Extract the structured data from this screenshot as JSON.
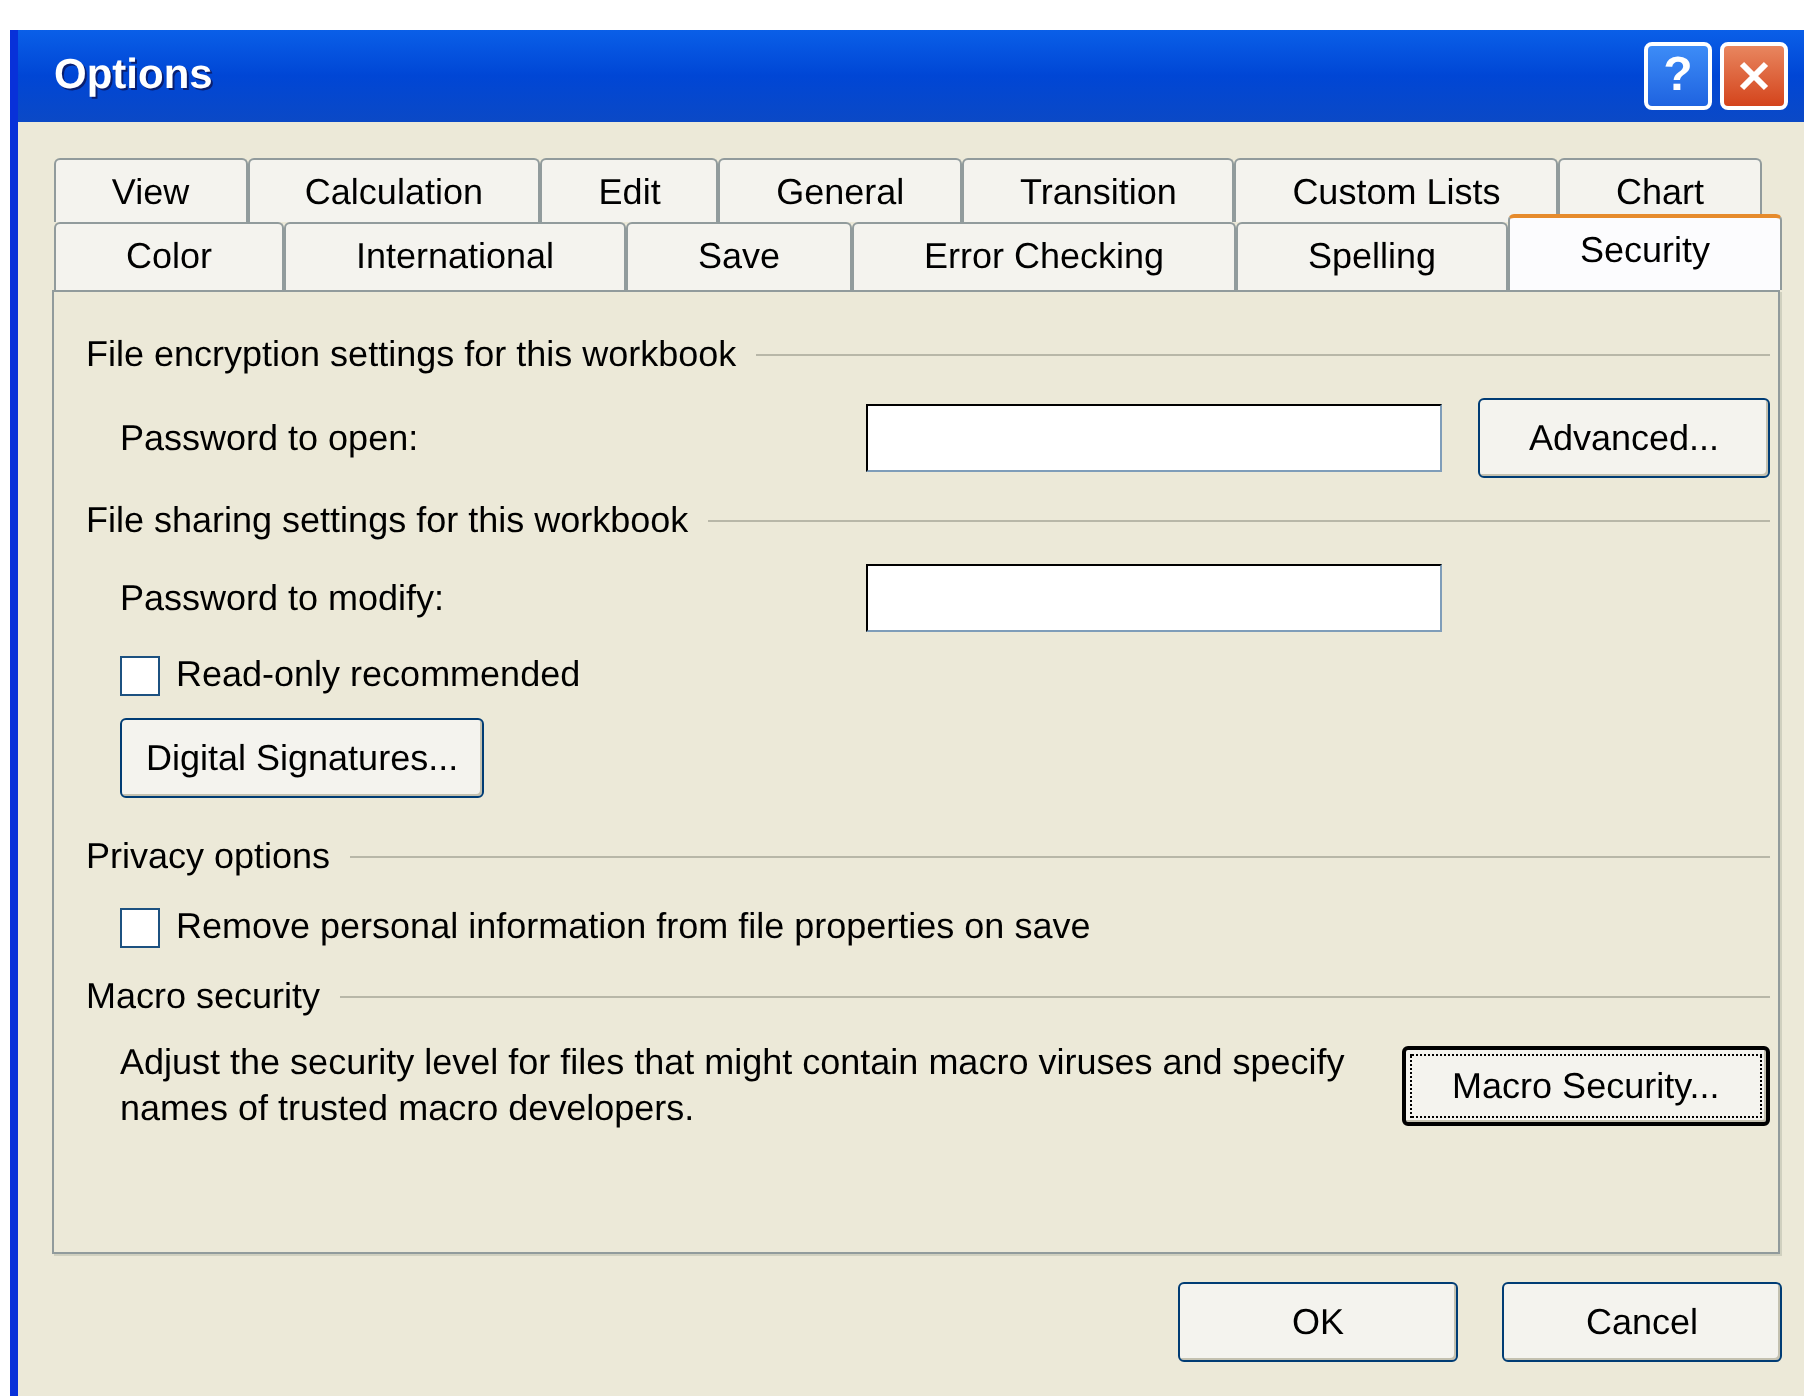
{
  "window": {
    "title": "Options"
  },
  "title_buttons": [
    {
      "kind": "help",
      "label": "?"
    },
    {
      "kind": "close"
    }
  ],
  "tab_rows": [
    [
      {
        "label": "View",
        "selected": false
      },
      {
        "label": "Calculation",
        "selected": false
      },
      {
        "label": "Edit",
        "selected": false
      },
      {
        "label": "General",
        "selected": false
      },
      {
        "label": "Transition",
        "selected": false
      },
      {
        "label": "Custom Lists",
        "selected": false
      },
      {
        "label": "Chart",
        "selected": false
      }
    ],
    [
      {
        "label": "Color",
        "selected": false
      },
      {
        "label": "International",
        "selected": false
      },
      {
        "label": "Save",
        "selected": false
      },
      {
        "label": "Error Checking",
        "selected": false
      },
      {
        "label": "Spelling",
        "selected": false
      },
      {
        "label": "Security",
        "selected": true
      }
    ]
  ],
  "sections": [
    {
      "heading": "File encryption settings for this workbook",
      "items": [
        {
          "kind": "password",
          "label": "Password to open:",
          "button": "Advanced...",
          "focused": false
        }
      ]
    },
    {
      "heading": "File sharing settings for this workbook",
      "items": [
        {
          "kind": "password",
          "label": "Password to modify:"
        },
        {
          "kind": "checkbox",
          "label": "Read-only recommended",
          "checked": false
        },
        {
          "kind": "button",
          "label": "Digital Signatures...",
          "focused": false
        }
      ]
    },
    {
      "heading": "Privacy options",
      "items": [
        {
          "kind": "checkbox",
          "label": "Remove personal information from file properties on save",
          "checked": false
        }
      ]
    },
    {
      "heading": "Macro security",
      "items": [
        {
          "kind": "text_button",
          "text": "Adjust the security level for files that might contain macro viruses and specify names of trusted macro developers.",
          "button": "Macro Security...",
          "focused": true
        }
      ]
    }
  ],
  "footer_buttons": [
    "OK",
    "Cancel"
  ]
}
